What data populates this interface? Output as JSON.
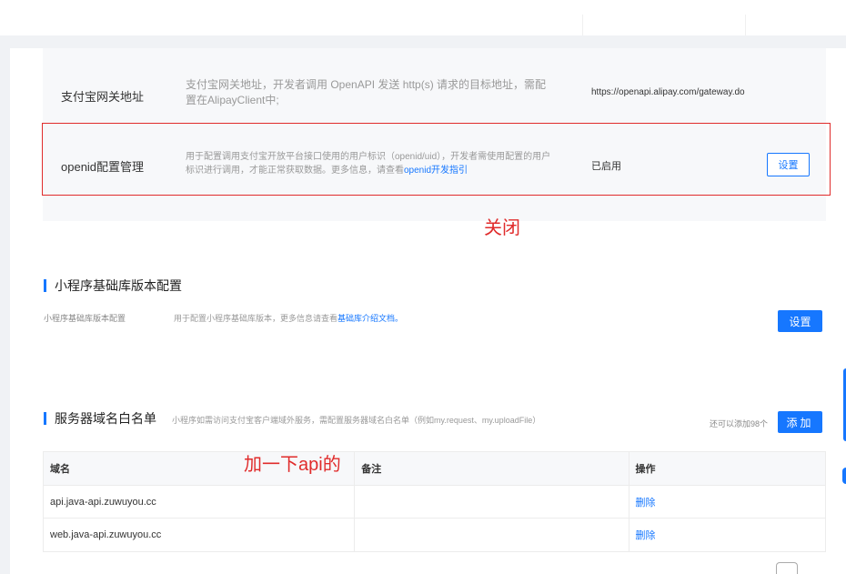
{
  "gateway": {
    "name": "支付宝网关地址",
    "desc": "支付宝网关地址，开发者调用 OpenAPI 发送 http(s) 请求的目标地址，需配置在AlipayClient中;",
    "value": "https://openapi.alipay.com/gateway.do"
  },
  "openid": {
    "name": "openid配置管理",
    "desc": "用于配置调用支付宝开放平台接口使用的用户标识（openid/uid），开发者需使用配置的用户标识进行调用，才能正常获取数据。更多信息，请查看",
    "link": "openid开发指引",
    "status": "已启用",
    "button": "设置"
  },
  "annotations": {
    "close_note": "关闭",
    "api_note": "加一下api的"
  },
  "sdk_section": {
    "title": "小程序基础库版本配置",
    "label": "小程序基础库版本配置",
    "desc": "用于配置小程序基础库版本，更多信息请查看",
    "link": "基础库介绍文档。",
    "button": "设置"
  },
  "domain_section": {
    "title": "服务器域名白名单",
    "desc": "小程序如需访问支付宝客户端域外服务，需配置服务器域名白名单（例如my.request、my.uploadFile）",
    "quota": "还可以添加98个",
    "button": "添加"
  },
  "domain_table": {
    "headers": [
      "域名",
      "备注",
      "操作"
    ],
    "rows": [
      {
        "domain": "api.java-api.zuwuyou.cc",
        "remark": "",
        "action": "删除"
      },
      {
        "domain": "web.java-api.zuwuyou.cc",
        "remark": "",
        "action": "删除"
      }
    ]
  },
  "colors": {
    "accent": "#1677ff",
    "annotation_red": "#e02b2b",
    "panel_bg": "#f7f8fa"
  }
}
